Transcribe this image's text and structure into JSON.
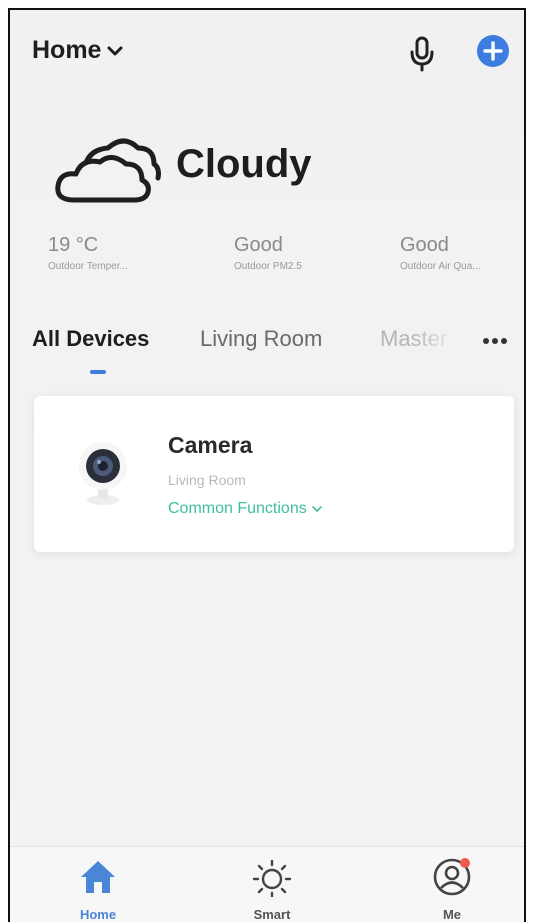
{
  "header": {
    "home_label": "Home",
    "dropdown_icon": "chevron-down-icon",
    "mic_icon": "microphone-icon",
    "add_icon": "plus-circle-icon",
    "accent_color": "#3d7de0"
  },
  "weather": {
    "icon": "cloud-icon",
    "condition": "Cloudy",
    "stats": [
      {
        "value": "19 °C",
        "label": "Outdoor Temper..."
      },
      {
        "value": "Good",
        "label": "Outdoor PM2.5"
      },
      {
        "value": "Good",
        "label": "Outdoor Air Qua..."
      }
    ]
  },
  "tabs": [
    {
      "label": "All Devices",
      "active": true
    },
    {
      "label": "Living Room",
      "active": false
    },
    {
      "label": "Master",
      "active": false
    }
  ],
  "devices": [
    {
      "name": "Camera",
      "room": "Living Room",
      "functions_label": "Common Functions",
      "icon": "camera-icon",
      "functions_color": "#3fbf9f"
    }
  ],
  "nav": {
    "items": [
      {
        "label": "Home",
        "icon": "home-icon",
        "active": true
      },
      {
        "label": "Smart",
        "icon": "sun-icon",
        "active": false
      },
      {
        "label": "Me",
        "icon": "user-icon",
        "active": false,
        "badge": true
      }
    ],
    "active_color": "#4a86d8",
    "badge_color": "#f05a4a"
  }
}
